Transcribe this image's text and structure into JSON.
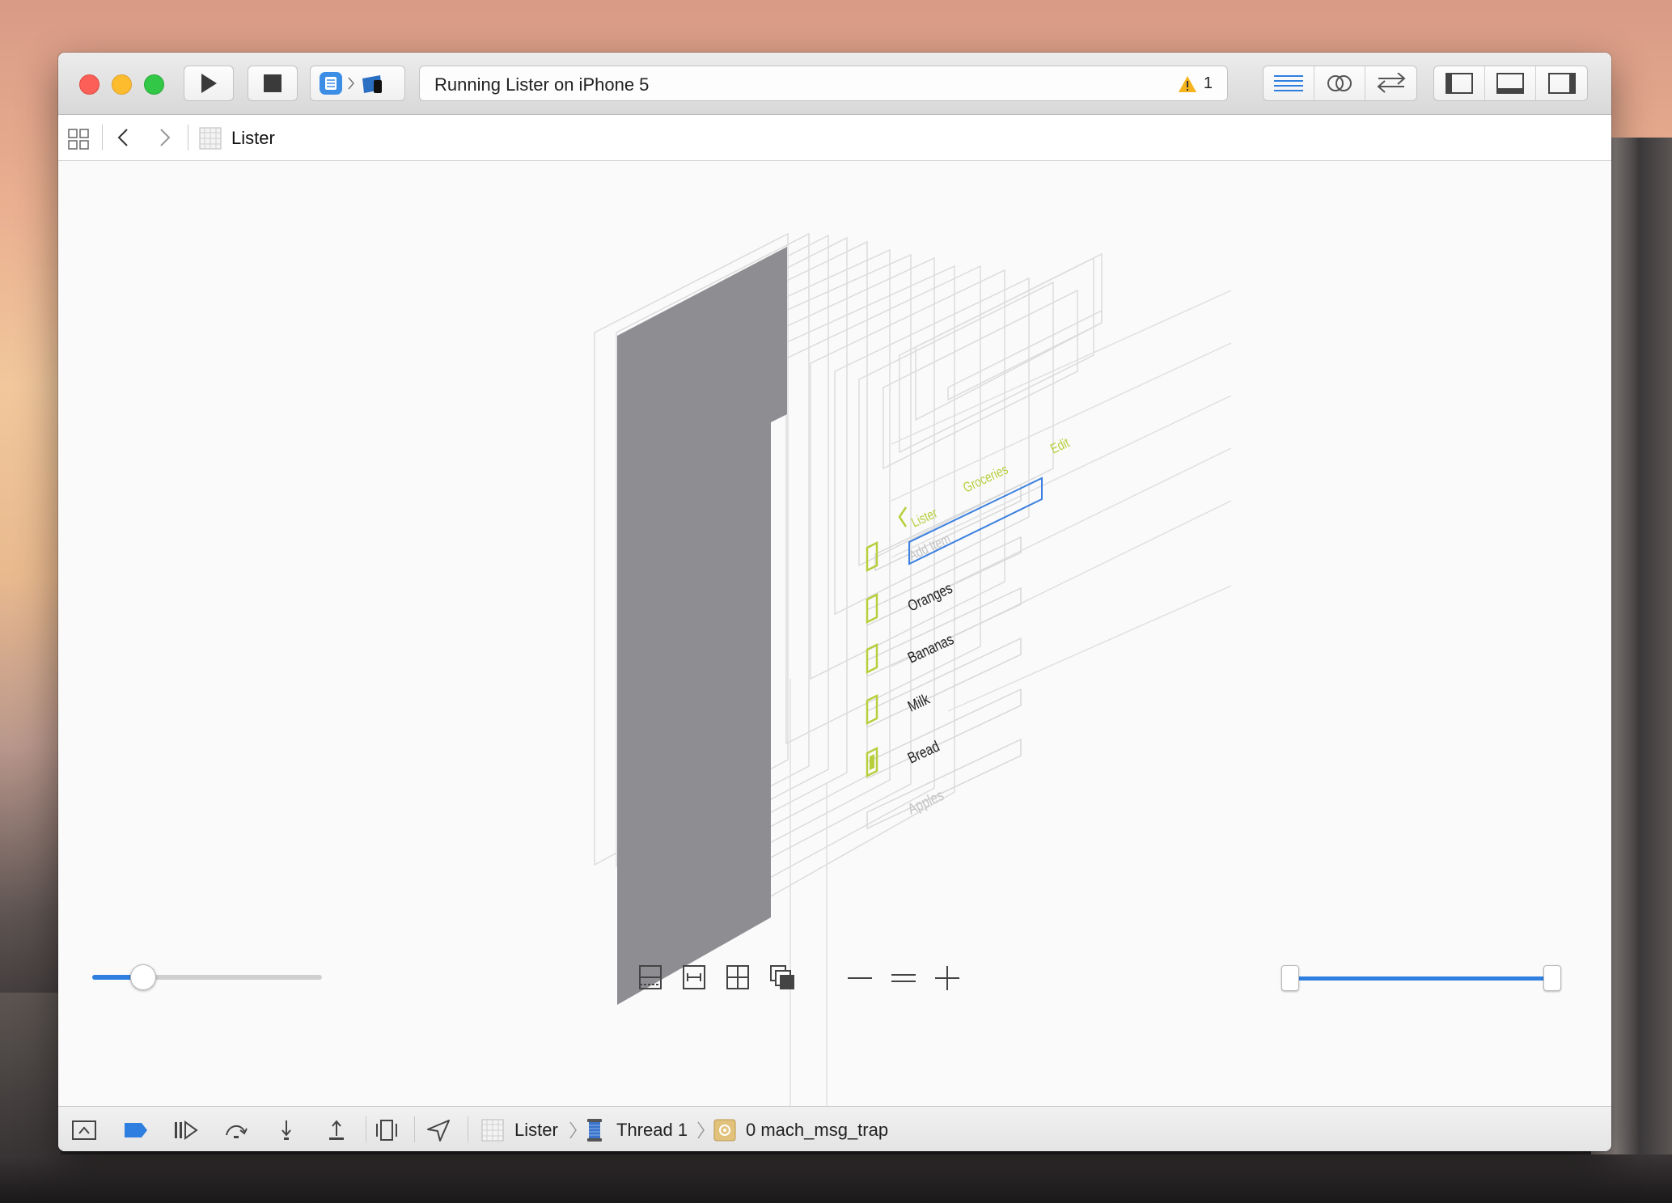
{
  "window": {
    "status_text": "Running Lister on iPhone 5",
    "warning_count": "1"
  },
  "jumpbar": {
    "crumb": "Lister"
  },
  "hierarchy": {
    "nav_back": "Lister",
    "nav_title": "Groceries",
    "edit_button": "Edit",
    "add_placeholder": "Add Item",
    "items": [
      {
        "label": "Oranges",
        "checked": false
      },
      {
        "label": "Bananas",
        "checked": false
      },
      {
        "label": "Milk",
        "checked": false
      },
      {
        "label": "Bread",
        "checked": false
      },
      {
        "label": "Apples",
        "checked": true
      }
    ]
  },
  "controls": {
    "spacing_slider": 0.22,
    "range_low": 0.0,
    "range_high": 1.0
  },
  "debugbar": {
    "crumb_app": "Lister",
    "crumb_thread": "Thread 1",
    "crumb_frame": "0 mach_msg_trap"
  },
  "colors": {
    "accent": "#2f7fe0",
    "green": "#b7cf3c",
    "layer_fill": "#8e8d92",
    "close": "#fc5f57",
    "minimize": "#fdbc2e",
    "zoom": "#33c748"
  }
}
